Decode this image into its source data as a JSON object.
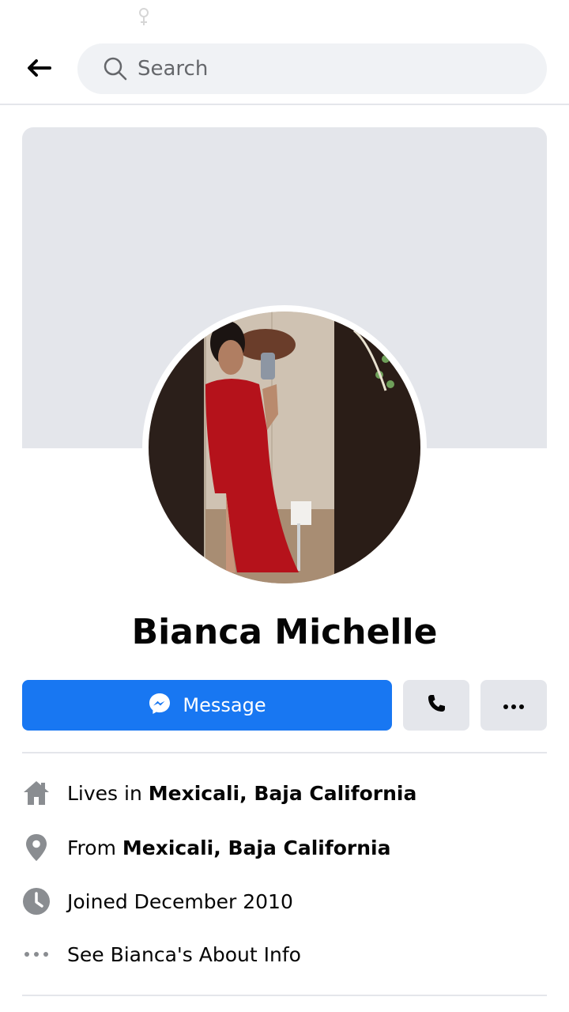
{
  "header": {
    "search_placeholder": "Search"
  },
  "profile": {
    "name": "Bianca Michelle"
  },
  "actions": {
    "message_label": "Message"
  },
  "intro": {
    "lives_prefix": "Lives in ",
    "lives_place": "Mexicali, Baja California",
    "from_prefix": "From ",
    "from_place": "Mexicali, Baja California",
    "joined": "Joined December 2010",
    "about_link": "See Bianca's About Info"
  },
  "colors": {
    "accent": "#1877f2",
    "icon_gray": "#8a8d91",
    "surface_gray": "#e4e6eb"
  },
  "icons": [
    "back-arrow-icon",
    "search-icon",
    "messenger-icon",
    "phone-icon",
    "more-icon",
    "home-icon",
    "location-pin-icon",
    "clock-icon",
    "ellipsis-icon"
  ]
}
